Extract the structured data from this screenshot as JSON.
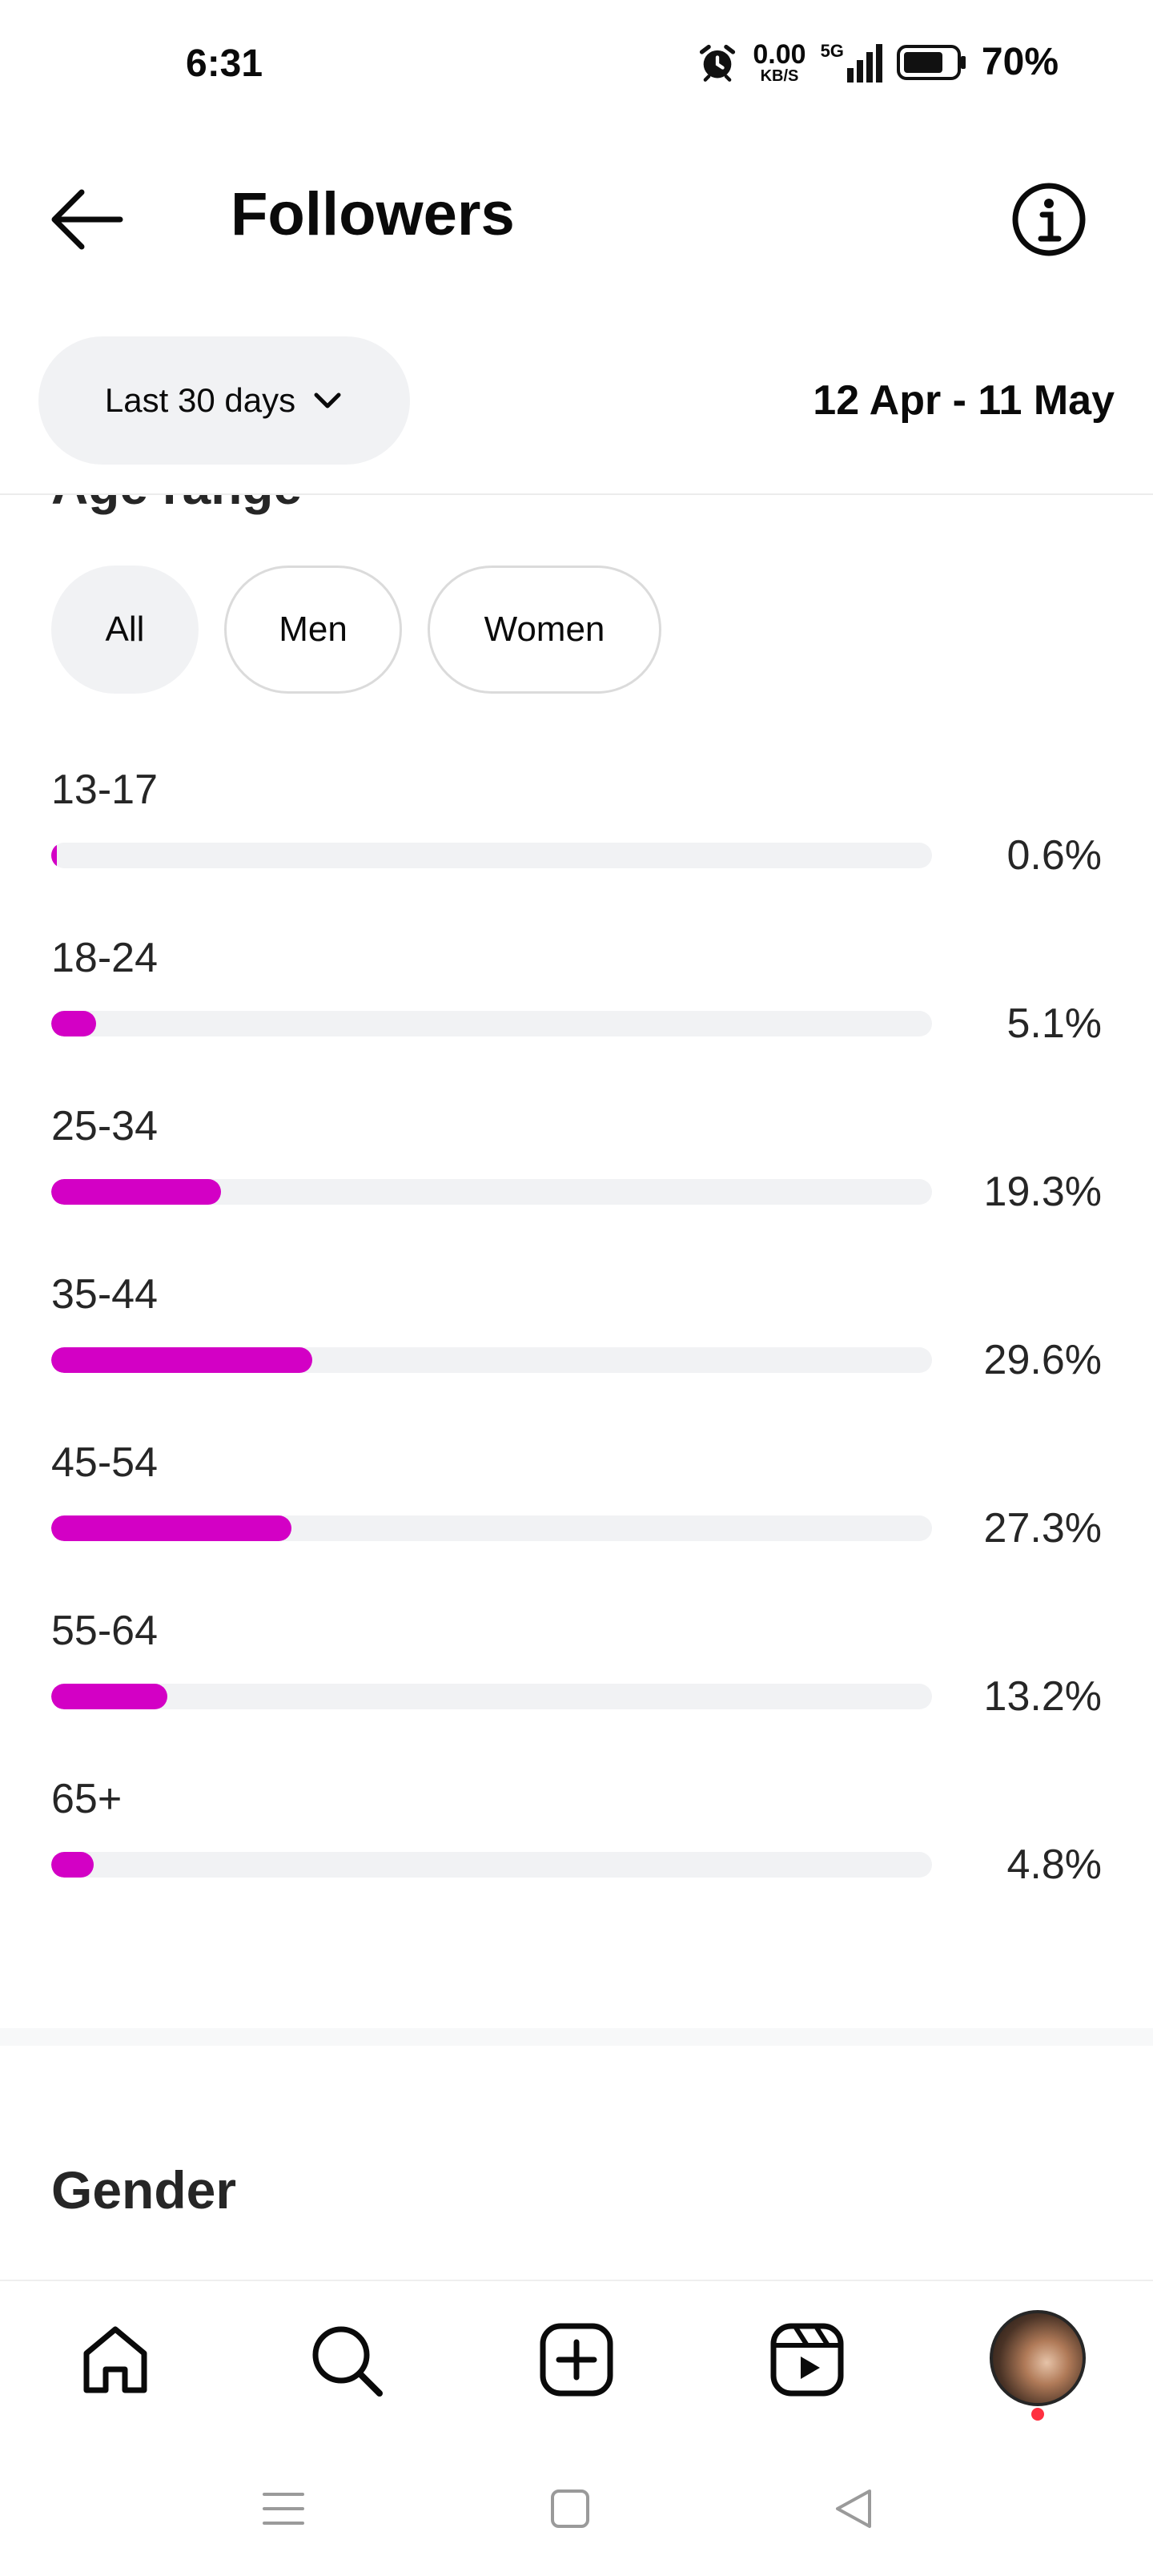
{
  "status_bar": {
    "time": "6:31",
    "net_speed_value": "0.00",
    "net_speed_unit": "KB/S",
    "network_type": "5G",
    "battery_percent": "70%"
  },
  "header": {
    "title": "Followers"
  },
  "filters": {
    "range_label": "Last 30 days",
    "date_range": "12 Apr - 11 May"
  },
  "age_section": {
    "heading": "Age range",
    "segments": [
      {
        "label": "All",
        "selected": true
      },
      {
        "label": "Men",
        "selected": false
      },
      {
        "label": "Women",
        "selected": false
      }
    ],
    "bar_color": "#d300c5",
    "bars": [
      {
        "label": "13-17",
        "value": 0.6,
        "display": "0.6%"
      },
      {
        "label": "18-24",
        "value": 5.1,
        "display": "5.1%"
      },
      {
        "label": "25-34",
        "value": 19.3,
        "display": "19.3%"
      },
      {
        "label": "35-44",
        "value": 29.6,
        "display": "29.6%"
      },
      {
        "label": "45-54",
        "value": 27.3,
        "display": "27.3%"
      },
      {
        "label": "55-64",
        "value": 13.2,
        "display": "13.2%"
      },
      {
        "label": "65+",
        "value": 4.8,
        "display": "4.8%"
      }
    ]
  },
  "gender_section": {
    "heading": "Gender"
  },
  "bottom_nav": {
    "items": [
      "home-icon",
      "search-icon",
      "create-post-icon",
      "reels-icon",
      "profile-avatar"
    ],
    "notification_dot_color": "#ff3040"
  },
  "system_nav": {
    "items": [
      "menu-icon",
      "home-square-icon",
      "back-triangle-icon"
    ]
  }
}
